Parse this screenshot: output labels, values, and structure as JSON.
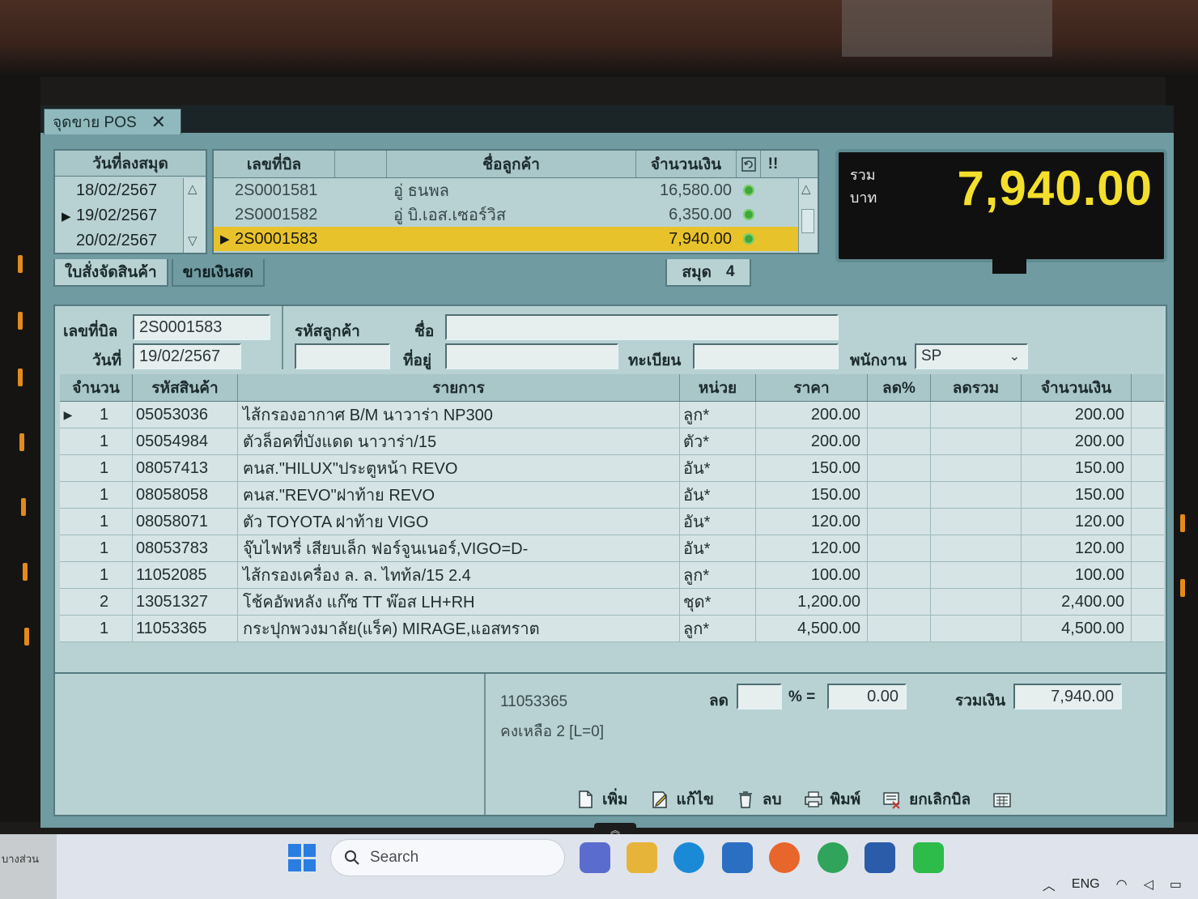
{
  "window": {
    "tab_title": "จุดขาย POS",
    "close_glyph": "✕"
  },
  "date_list": {
    "header": "วันที่ลงสมุด",
    "items": [
      "18/02/2567",
      "19/02/2567",
      "20/02/2567"
    ],
    "selected_index": 1
  },
  "bill_list": {
    "headers": {
      "bill_no": "เลขที่บิล",
      "customer": "ชื่อลูกค้า",
      "amount": "จำนวนเงิน",
      "refresh_icon": "refresh-icon",
      "alert_icon": "!!"
    },
    "rows": [
      {
        "bill_no": "2S0001581",
        "customer": "อู่ ธนพล",
        "amount": "16,580.00"
      },
      {
        "bill_no": "2S0001582",
        "customer": "อู่ บิ.เอส.เซอร์วิส",
        "amount": "6,350.00"
      },
      {
        "bill_no": "2S0001583",
        "customer": "",
        "amount": "7,940.00"
      }
    ],
    "selected_index": 2
  },
  "sub_tabs": [
    "ใบสั่งจัดสินค้า",
    "ขายเงินสด"
  ],
  "book": {
    "label": "สมุด",
    "value": "4"
  },
  "total": {
    "label_line1": "รวม",
    "label_line2": "บาท",
    "value": "7,940.00"
  },
  "form": {
    "bill_no_label": "เลขที่บิล",
    "bill_no": "2S0001583",
    "date_label": "วันที่",
    "date": "19/02/2567",
    "customer_code_label": "รหัสลูกค้า",
    "customer_code": "",
    "name_label": "ชื่อ",
    "name": "",
    "address_label": "ที่อยู่",
    "address": "",
    "registration_label": "ทะเบียน",
    "registration": "",
    "employee_label": "พนักงาน",
    "employee": "SP"
  },
  "grid": {
    "headers": {
      "qty": "จำนวน",
      "code": "รหัสสินค้า",
      "desc": "รายการ",
      "unit": "หน่วย",
      "price": "ราคา",
      "disc_pct": "ลด%",
      "disc_total": "ลดรวม",
      "amount": "จำนวนเงิน"
    },
    "rows": [
      {
        "qty": "1",
        "code": "05053036",
        "desc": "ไส้กรองอากาศ B/M นาวาร่า NP300",
        "unit": "ลูก*",
        "price": "200.00",
        "amount": "200.00"
      },
      {
        "qty": "1",
        "code": "05054984",
        "desc": "ตัวล็อคที่บังแดด นาวาร่า/15",
        "unit": "ตัว*",
        "price": "200.00",
        "amount": "200.00"
      },
      {
        "qty": "1",
        "code": "08057413",
        "desc": "ฅนส.\"HILUX\"ประตูหน้า REVO",
        "unit": "อัน*",
        "price": "150.00",
        "amount": "150.00"
      },
      {
        "qty": "1",
        "code": "08058058",
        "desc": "ฅนส.\"REVO\"ฝาท้าย REVO",
        "unit": "อัน*",
        "price": "150.00",
        "amount": "150.00"
      },
      {
        "qty": "1",
        "code": "08058071",
        "desc": "ตัว TOYOTA ฝาท้าย VIGO",
        "unit": "อัน*",
        "price": "120.00",
        "amount": "120.00"
      },
      {
        "qty": "1",
        "code": "08053783",
        "desc": "จุ๊บไฟหรี่ เสียบเล็ก ฟอร์จูนเนอร์,VIGO=D-",
        "unit": "อัน*",
        "price": "120.00",
        "amount": "120.00"
      },
      {
        "qty": "1",
        "code": "11052085",
        "desc": "ไส้กรองเครื่อง ล. ล. ไทท้ล/15 2.4",
        "unit": "ลูก*",
        "price": "100.00",
        "amount": "100.00"
      },
      {
        "qty": "2",
        "code": "13051327",
        "desc": "โช้คอัพหลัง แก๊ซ TT พ๊อส LH+RH",
        "unit": "ชุด*",
        "price": "1,200.00",
        "amount": "2,400.00"
      },
      {
        "qty": "1",
        "code": "11053365",
        "desc": "กระปุกพวงมาลัย(แร็ค) MIRAGE,แอสทราต",
        "unit": "ลูก*",
        "price": "4,500.00",
        "amount": "4,500.00"
      }
    ]
  },
  "summary": {
    "item_code": "11053365",
    "remaining": "คงเหลือ 2 [L=0]",
    "discount_label": "ลด",
    "discount_pct": "",
    "pct_eq": "% =",
    "discount_value": "0.00",
    "total_label": "รวมเงิน",
    "total_value": "7,940.00"
  },
  "toolbar": {
    "add": "เพิ่ม",
    "edit": "แก้ไข",
    "delete": "ลบ",
    "print": "พิมพ์",
    "cancel_bill": "ยกเลิกบิล"
  },
  "taskbar": {
    "search_placeholder": "Search",
    "lang": "ENG",
    "peek_text": "บางส่วน"
  },
  "colors": {
    "app_bg": "#6f9ba1",
    "panel": "#b8d2d4",
    "selected_row": "#e8c22a",
    "total_text": "#f4df2c"
  }
}
